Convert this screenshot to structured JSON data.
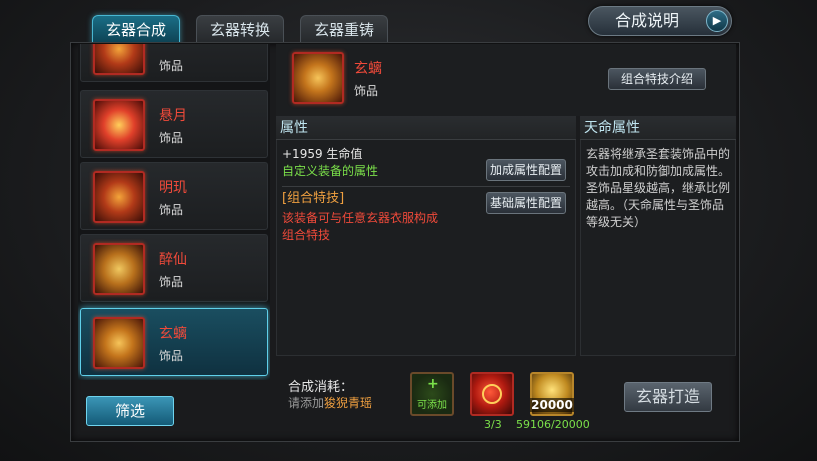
{
  "tabs": [
    {
      "label": "玄器合成"
    },
    {
      "label": "玄器转换"
    },
    {
      "label": "玄器重铸"
    }
  ],
  "help_button": {
    "label": "合成说明"
  },
  "sidebar": {
    "items": [
      {
        "name": "",
        "type": "饰品"
      },
      {
        "name": "悬月",
        "type": "饰品"
      },
      {
        "name": "明玑",
        "type": "饰品"
      },
      {
        "name": "醉仙",
        "type": "饰品"
      },
      {
        "name": "玄螭",
        "type": "饰品",
        "selected": true
      }
    ],
    "filter_label": "筛选"
  },
  "selected_item": {
    "name": "玄螭",
    "type": "饰品",
    "combo_intro_button": "组合特技介绍"
  },
  "attributes": {
    "heading": "属性",
    "stat": "+1959 生命值",
    "custom": "自定义装备的属性",
    "bonus_config_button": "加成属性配置",
    "combo_title": "[组合特技]",
    "combo_desc": "该装备可与任意玄器衣服构成组合特技",
    "base_config_button": "基础属性配置"
  },
  "destiny": {
    "heading": "天命属性",
    "text": "玄器将继承圣套装饰品中的攻击加成和防御加成属性。圣饰品星级越高，继承比例越高。（天命属性与圣饰品等级无关）"
  },
  "cost": {
    "label": "合成消耗：",
    "hint_prefix": "请添加",
    "hint_item": "狻猊青瑶",
    "slots": [
      {
        "label": "可添加",
        "count": ""
      },
      {
        "label": "",
        "count": "3/3"
      },
      {
        "label": "20000",
        "count": "59106/20000"
      }
    ]
  },
  "make_button": {
    "label": "玄器打造"
  },
  "colors": {
    "item_name": "#f04a3a",
    "accent_teal": "#49b7d2",
    "custom_attr": "#7be04a",
    "combo": "#f0a040",
    "combo_desc": "#f04a3a",
    "count_ok": "#7be04a"
  }
}
